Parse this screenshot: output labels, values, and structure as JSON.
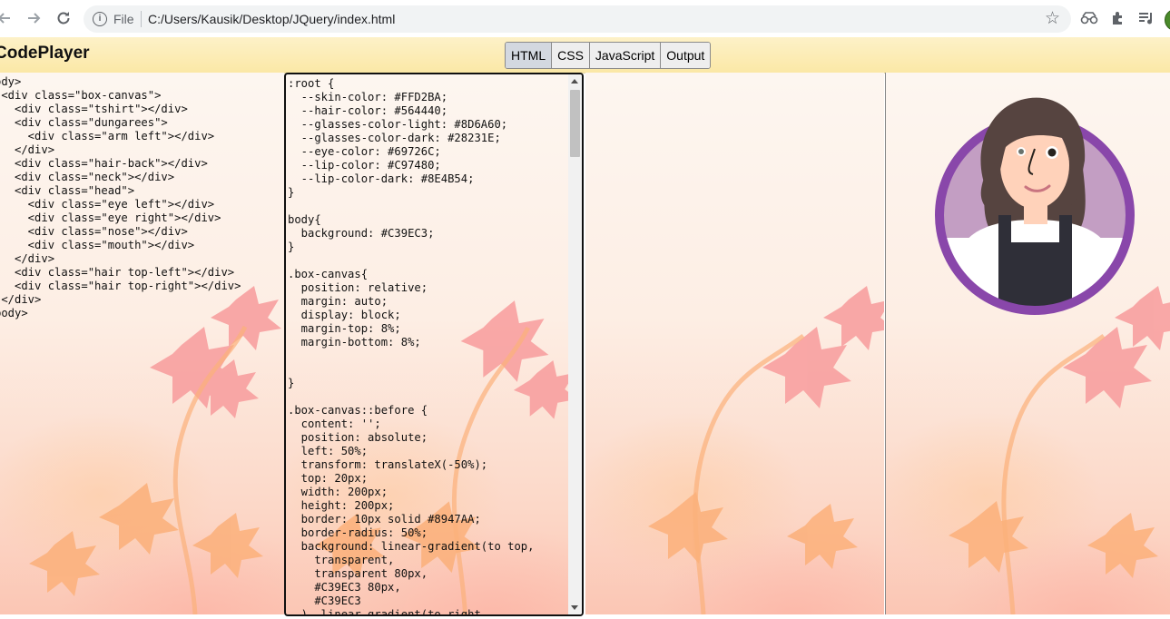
{
  "browser": {
    "file_label": "File",
    "url": "C:/Users/Kausik/Desktop/JQuery/index.html"
  },
  "app": {
    "title": "CodePlayer",
    "toggles": [
      "HTML",
      "CSS",
      "JavaScript",
      "Output"
    ],
    "active_toggle": "HTML"
  },
  "html_code": "ody>\n <div class=\"box-canvas\">\n   <div class=\"tshirt\"></div>\n   <div class=\"dungarees\">\n     <div class=\"arm left\"></div>\n   </div>\n   <div class=\"hair-back\"></div>\n   <div class=\"neck\"></div>\n   <div class=\"head\">\n     <div class=\"eye left\"></div>\n     <div class=\"eye right\"></div>\n     <div class=\"nose\"></div>\n     <div class=\"mouth\"></div>\n   </div>\n   <div class=\"hair top-left\"></div>\n   <div class=\"hair top-right\"></div>\n </div>\nbody>",
  "css_code": ":root {\n  --skin-color: #FFD2BA;\n  --hair-color: #564440;\n  --glasses-color-light: #8D6A60;\n  --glasses-color-dark: #28231E;\n  --eye-color: #69726C;\n  --lip-color: #C97480;\n  --lip-color-dark: #8E4B54;\n}\n\nbody{\n  background: #C39EC3;\n}\n\n.box-canvas{\n  position: relative;\n  margin: auto;\n  display: block;\n  margin-top: 8%;\n  margin-bottom: 8%;\n\n\n}\n\n.box-canvas::before {\n  content: '';\n  position: absolute;\n  left: 50%;\n  transform: translateX(-50%);\n  top: 20px;\n  width: 200px;\n  height: 200px;\n  border: 10px solid #8947AA;\n  border-radius: 50%;\n  background: linear-gradient(to top,\n    transparent,\n    transparent 80px,\n    #C39EC3 80px,\n    #C39EC3\n  ), linear-gradient(to right,",
  "colors": {
    "circle_border": "#8947AA",
    "circle_fill": "#C39EC3",
    "skin": "#FFD2BA",
    "hair": "#564440",
    "eye": "#69726C",
    "lip": "#C97480",
    "dungarees": "#2f2f38",
    "tshirt": "#ffffff"
  }
}
